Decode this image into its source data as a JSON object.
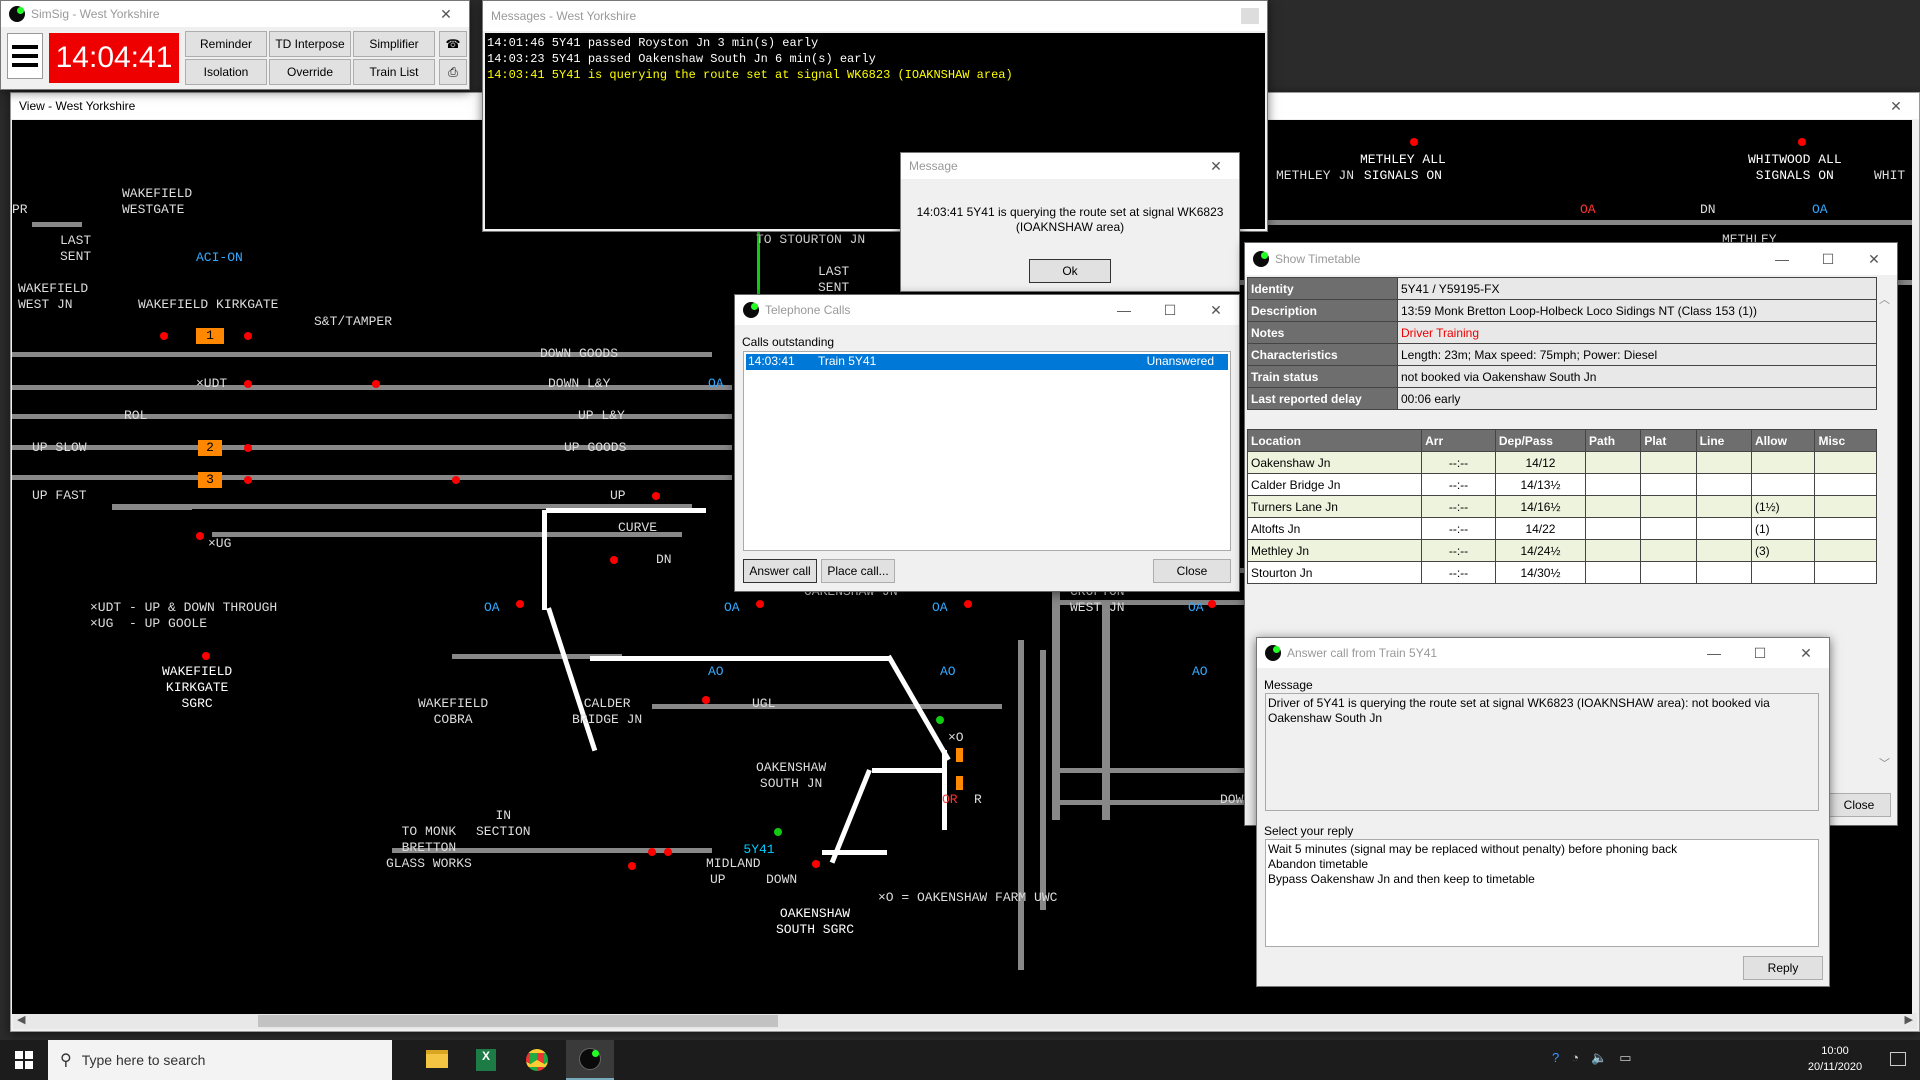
{
  "main_window": {
    "title": "SimSig - West Yorkshire",
    "clock": "14:04:41",
    "buttons": [
      "Reminder",
      "TD Interpose",
      "Simplifier",
      "Isolation",
      "Override",
      "Train List"
    ]
  },
  "view_window": {
    "title": "View - West Yorkshire"
  },
  "diagram": {
    "labels": {
      "wakefield_westgate": "WAKEFIELD\nWESTGATE",
      "last_sent": "LAST\nSENT",
      "aci_on": "ACI-ON",
      "wakefield_west_jn": "WAKEFIELD\nWEST JN",
      "wakefield_kirkgate": "WAKEFIELD KIRKGATE",
      "st_tamper": "S&T/TAMPER",
      "down_goods": "DOWN GOODS",
      "udt": "×UDT",
      "down_ly": "DOWN L&Y",
      "rol": "ROL",
      "up_ly": "UP L&Y",
      "up_slow": "UP SLOW",
      "up_goods": "UP GOODS",
      "up_fast": "UP FAST",
      "ug": "×UG",
      "up_curve": "UP",
      "curve": "CURVE",
      "dn": "DN",
      "legend_udt": "×UDT - UP & DOWN THROUGH",
      "legend_ug": "×UG  - UP GOOLE",
      "kirkgate_sgrc": "WAKEFIELD\nKIRKGATE\nSGRC",
      "to_stourton": "TO STOURTON JN",
      "last_sent_2": "LAST\nSENT",
      "wakefield_cobra": "WAKEFIELD\nCOBRA",
      "calder_bridge": "CALDER\nBRIDGE JN",
      "ugl": "UGL",
      "oakenshaw_jn": "OAKENSHAW JN",
      "oakenshaw_south_jn": "OAKENSHAW\nSOUTH JN",
      "x0": "×O",
      "to_monk": "TO MONK\nBRETTON\nGLASS WORKS",
      "in_section": "IN\nSECTION",
      "midland": "MIDLAND",
      "up_midland": "UP",
      "down_midland": "DOWN",
      "legend_x0": "×O = OAKENSHAW FARM UWC",
      "oakenshaw_sgrc": "OAKENSHAW\nSOUTH SGRC",
      "methley_all": "METHLEY ALL\nSIGNALS ON",
      "methley_jn": "METHLEY JN",
      "whitwood_all": "WHITWOOD ALL\nSIGNALS ON",
      "whit": "WHIT",
      "dn_right": "DN",
      "methley": "METHLEY",
      "crofton": "CROFTON\nWEST JN",
      "dow": "DOW",
      "berth_1": "1",
      "berth_2": "2",
      "berth_3": "3",
      "train_5y41": "5Y41",
      "pr": "PR",
      "oa": "OA",
      "ao": "AO",
      "or": "OR",
      "r": "R"
    }
  },
  "messages_window": {
    "title": "Messages - West Yorkshire",
    "lines": [
      {
        "text": "14:01:46 5Y41 passed Royston Jn 3 min(s) early",
        "color": "#ffffff"
      },
      {
        "text": "14:03:23 5Y41 passed Oakenshaw South Jn 6 min(s) early",
        "color": "#ffffff"
      },
      {
        "text": "14:03:41 5Y41 is querying the route set at signal WK6823 (IOAKNSHAW area)",
        "color": "#ffff00"
      }
    ]
  },
  "message_dialog": {
    "title": "Message",
    "text": "14:03:41 5Y41 is querying the route set at signal WK6823 (IOAKNSHAW area)",
    "ok": "Ok"
  },
  "telephone_window": {
    "title": "Telephone Calls",
    "section": "Calls outstanding",
    "calls": [
      {
        "time": "14:03:41",
        "caller": "Train 5Y41",
        "status": "Unanswered"
      }
    ],
    "answer": "Answer call",
    "place": "Place call...",
    "close": "Close"
  },
  "timetable_window": {
    "title": "Show Timetable",
    "info": [
      {
        "label": "Identity",
        "value": "5Y41 / Y59195-FX",
        "red": false
      },
      {
        "label": "Description",
        "value": "13:59 Monk Bretton Loop-Holbeck Loco Sidings NT (Class 153 (1))",
        "red": false
      },
      {
        "label": "Notes",
        "value": "Driver Training",
        "red": true
      },
      {
        "label": "Characteristics",
        "value": "Length: 23m; Max speed: 75mph; Power: Diesel",
        "red": false
      },
      {
        "label": "Train status",
        "value": "not booked via Oakenshaw South Jn",
        "red": false
      },
      {
        "label": "Last reported delay",
        "value": "00:06 early",
        "red": false
      }
    ],
    "columns": [
      "Location",
      "Arr",
      "Dep/Pass",
      "Path",
      "Plat",
      "Line",
      "Allow",
      "Misc"
    ],
    "rows": [
      [
        "Oakenshaw Jn",
        "--:--",
        "14/12",
        "",
        "",
        "",
        "",
        ""
      ],
      [
        "Calder Bridge Jn",
        "--:--",
        "14/13½",
        "",
        "",
        "",
        "",
        ""
      ],
      [
        "Turners Lane Jn",
        "--:--",
        "14/16½",
        "",
        "",
        "",
        "(1½)",
        ""
      ],
      [
        "Altofts Jn",
        "--:--",
        "14/22",
        "",
        "",
        "",
        "(1)",
        ""
      ],
      [
        "Methley Jn",
        "--:--",
        "14/24½",
        "",
        "",
        "",
        "(3)",
        ""
      ],
      [
        "Stourton Jn",
        "--:--",
        "14/30½",
        "",
        "",
        "",
        "",
        ""
      ]
    ],
    "close": "Close"
  },
  "answer_window": {
    "title": "Answer call from Train 5Y41",
    "message_label": "Message",
    "message": "Driver of 5Y41 is querying the route set at signal WK6823 (IOAKNSHAW area): not booked via Oakenshaw South Jn",
    "reply_label": "Select your reply",
    "replies": [
      "Wait 5 minutes (signal may be replaced without penalty) before phoning back",
      "Abandon timetable",
      "Bypass Oakenshaw Jn and then keep to timetable"
    ],
    "reply_button": "Reply"
  },
  "taskbar": {
    "search_placeholder": "Type here to search",
    "time": "10:00",
    "date": "20/11/2020"
  }
}
